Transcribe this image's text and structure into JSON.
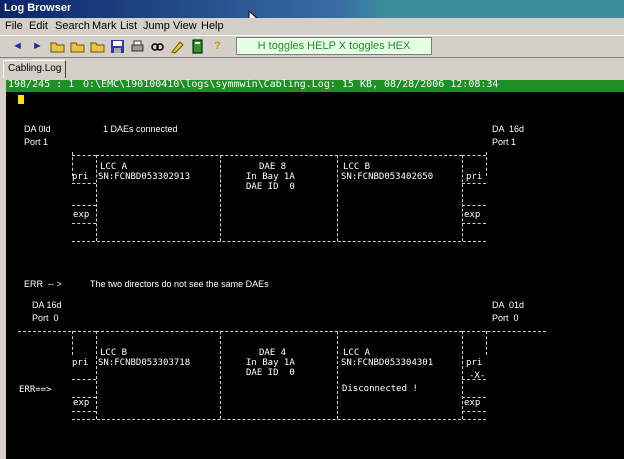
{
  "window": {
    "title": "Log Browser"
  },
  "menu": [
    "File",
    "Edit",
    "Search",
    "Mark",
    "List",
    "Jump",
    "View",
    "Help"
  ],
  "toolbar": {
    "buttons": [
      "back-arrow-icon",
      "forward-arrow-icon",
      "open-folder-icon",
      "open-folder-2-icon",
      "open-folder-3-icon",
      "save-icon",
      "print-icon",
      "find-icon",
      "mark-icon",
      "book-icon",
      "help-icon"
    ],
    "help_text": "H toggles HELP   X toggles HEX"
  },
  "tab": {
    "label": "Cabling.Log"
  },
  "path_bar": {
    "position": "198/245 : 1",
    "path": "O:\\EMC\\190100410\\logs\\symmwin\\Cabling.Log: 15 KB, 08/28/2006 12:08:34"
  },
  "colors": {
    "path_bar": "#1f8f26",
    "console_bg": "#000000",
    "cursor": "#ffe100",
    "title_bar": "#0a246a"
  },
  "section1": {
    "left_label_1": "DA 0ld",
    "left_label_2": "Port 1",
    "status": "1 DAEs connected",
    "right_label_1": "DA  16d",
    "right_label_2": "Port 1",
    "lcc_left_title": "LCC A",
    "lcc_left_sn": "SN:FCNBD053302913",
    "dae_title": "DAE 8",
    "dae_bay": "In Bay 1A",
    "dae_id": "DAE ID  0",
    "lcc_right_title": "LCC B",
    "lcc_right_sn": "SN:FCNBD053402650",
    "pri_left": "pri",
    "pri_right": "pri",
    "exp_left": "exp",
    "exp_right": "exp"
  },
  "error_line": {
    "label": "ERR  -- >",
    "message": "The two directors do not see the same DAEs"
  },
  "section2": {
    "left_label_1": "DA 16d",
    "left_label_2": "Port  0",
    "right_label_1": "DA  01d",
    "right_label_2": "Port  0",
    "err_marker": "ERR==>",
    "lcc_left_title": "LCC B",
    "lcc_left_sn": "SN:FCNBD053303718",
    "dae_title": "DAE 4",
    "dae_bay": "In Bay 1A",
    "dae_id": "DAE ID  0",
    "lcc_right_title": "LCC A",
    "lcc_right_sn": "SN:FCNBD053304301",
    "disconnected": "Disconnected !",
    "pri_left": "pri",
    "pri_right": "pri",
    "exp_left": "exp",
    "exp_right": "exp"
  }
}
